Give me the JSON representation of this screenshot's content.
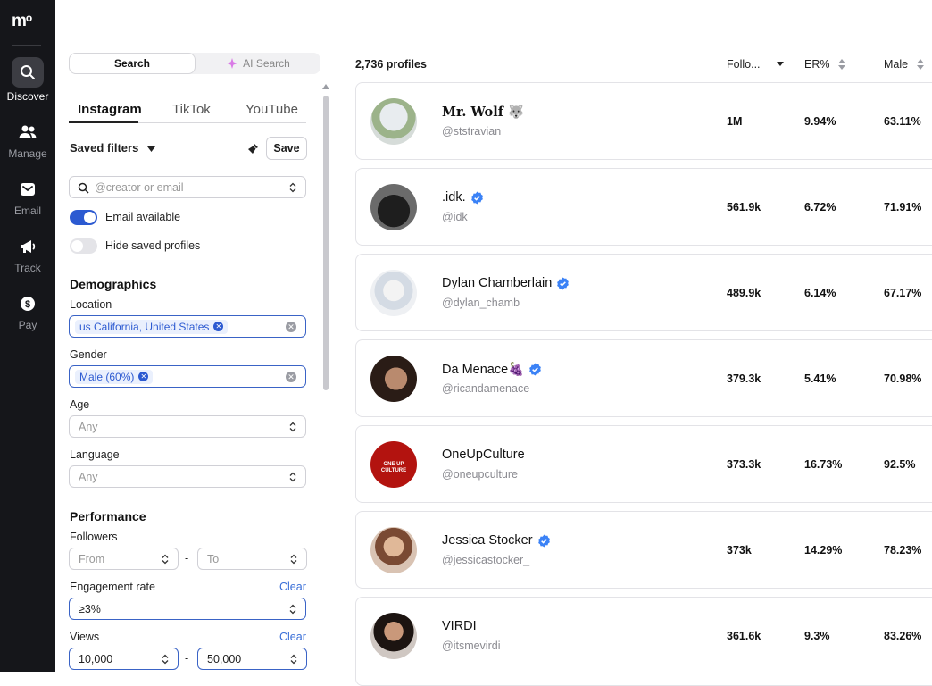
{
  "nav": {
    "logo": "m",
    "items": [
      {
        "label": "Discover"
      },
      {
        "label": "Manage"
      },
      {
        "label": "Email"
      },
      {
        "label": "Track"
      },
      {
        "label": "Pay"
      }
    ]
  },
  "filters": {
    "search_tab": "Search",
    "ai_search_tab": "AI Search",
    "platforms": [
      "Instagram",
      "TikTok",
      "YouTube"
    ],
    "saved_filters": "Saved filters",
    "save_button": "Save",
    "creator_placeholder": "@creator or email",
    "email_available": "Email available",
    "hide_saved": "Hide saved profiles",
    "demographics": "Demographics",
    "location_label": "Location",
    "location_chip": "us California, United States",
    "gender_label": "Gender",
    "gender_chip": "Male (60%)",
    "age_label": "Age",
    "age_value": "Any",
    "language_label": "Language",
    "language_value": "Any",
    "performance": "Performance",
    "followers_label": "Followers",
    "followers_from": "From",
    "followers_to": "To",
    "dash": "-",
    "engagement_label": "Engagement rate",
    "engagement_value": "≥3%",
    "clear": "Clear",
    "views_label": "Views",
    "views_from": "10,000",
    "views_to": "50,000"
  },
  "results": {
    "count": "2,736 profiles",
    "columns": {
      "followers": "Follo...",
      "er": "ER%",
      "male": "Male"
    },
    "profiles": [
      {
        "name": "Mr. Wolf 🐺",
        "handle": "@ststravian",
        "followers": "1M",
        "er": "9.94%",
        "male": "63.11%",
        "verified": false
      },
      {
        "name": ".idk.",
        "handle": "@idk",
        "followers": "561.9k",
        "er": "6.72%",
        "male": "71.91%",
        "verified": true
      },
      {
        "name": "Dylan Chamberlain",
        "handle": "@dylan_chamb",
        "followers": "489.9k",
        "er": "6.14%",
        "male": "67.17%",
        "verified": true
      },
      {
        "name": "Da Menace🍇",
        "handle": "@ricandamenace",
        "followers": "379.3k",
        "er": "5.41%",
        "male": "70.98%",
        "verified": true
      },
      {
        "name": "OneUpCulture",
        "handle": "@oneupculture",
        "followers": "373.3k",
        "er": "16.73%",
        "male": "92.5%",
        "verified": false,
        "avatar_text": "ONE UP CULTURE"
      },
      {
        "name": "Jessica Stocker",
        "handle": "@jessicastocker_",
        "followers": "373k",
        "er": "14.29%",
        "male": "78.23%",
        "verified": true
      },
      {
        "name": "VIRDI",
        "handle": "@itsmevirdi",
        "followers": "361.6k",
        "er": "9.3%",
        "male": "83.26%",
        "verified": false
      }
    ]
  },
  "colors": {
    "accent": "#2c5ad1",
    "nav_bg": "#15161a",
    "verified": "#3b82f6"
  }
}
